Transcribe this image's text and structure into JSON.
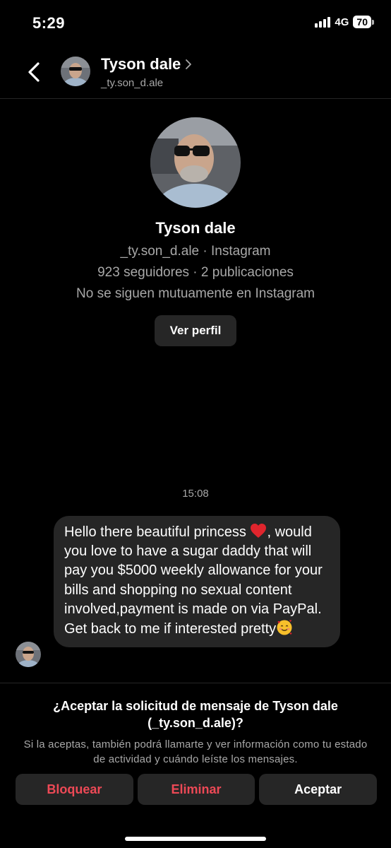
{
  "status_bar": {
    "time": "5:29",
    "network": "4G",
    "battery": "70"
  },
  "header": {
    "name": "Tyson dale",
    "handle": "_ty.son_d.ale",
    "back_icon": "chevron-left-icon",
    "profile_chevron_icon": "chevron-right-icon"
  },
  "profile": {
    "name": "Tyson dale",
    "handle_line": "_ty.son_d.ale · Instagram",
    "stats_line": "923 seguidores · 2 publicaciones",
    "follow_line": "No se siguen mutuamente en Instagram",
    "view_profile_label": "Ver perfil"
  },
  "messages": [
    {
      "timestamp": "15:08",
      "text_part1": "Hello there beautiful princess ",
      "text_part2": ", would you love to have a sugar daddy that will pay you $5000 weekly allowance for your bills and shopping no sexual content involved,payment is made on via PayPal. Get back to me if interested pretty",
      "emoji_1": "red-heart-icon",
      "emoji_2": "smiling-face-with-hearts-icon"
    }
  ],
  "request": {
    "title": "¿Aceptar la solicitud de mensaje de Tyson dale (_ty.son_d.ale)?",
    "description": "Si la aceptas, también podrá llamarte y ver información como tu estado de actividad y cuándo leíste los mensajes.",
    "block_label": "Bloquear",
    "delete_label": "Eliminar",
    "accept_label": "Aceptar"
  },
  "colors": {
    "background": "#000000",
    "surface": "#262626",
    "secondary_text": "#a8a8a8",
    "danger": "#ed4956"
  }
}
